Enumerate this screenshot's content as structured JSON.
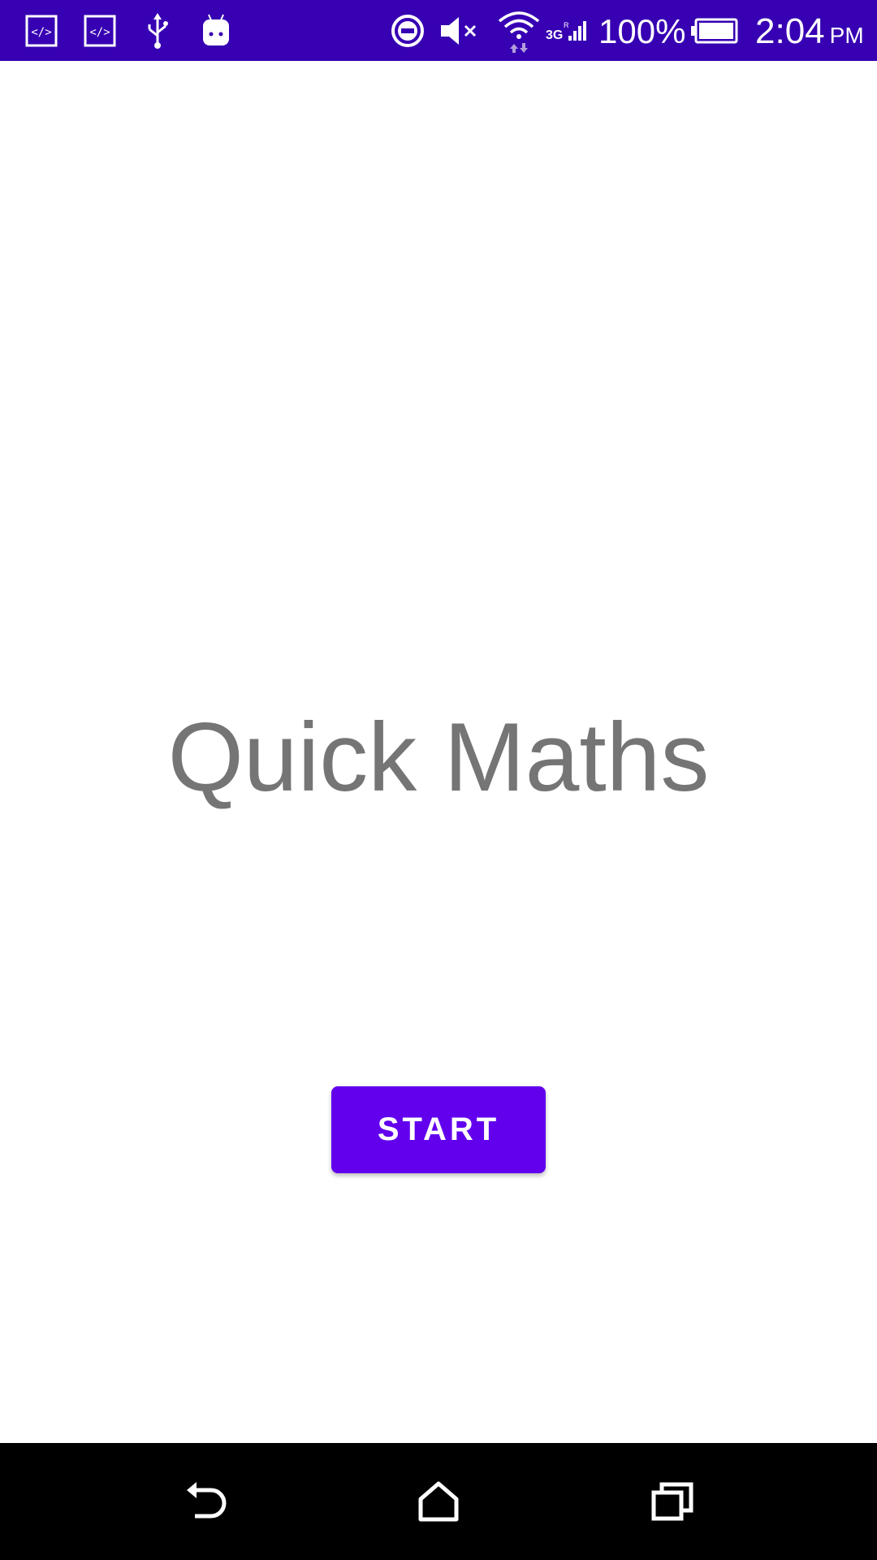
{
  "status_bar": {
    "background": "#3700b3",
    "left_icons": [
      "code-icon",
      "code-icon",
      "usb-icon",
      "android-icon"
    ],
    "right_icons": [
      "do-not-disturb-icon",
      "volume-muted-icon",
      "wifi-icon",
      "cellular-3g-signal-icon",
      "battery-icon"
    ],
    "network_label": "3G",
    "battery_percent": "100%",
    "time": "2:04",
    "ampm": "PM"
  },
  "main": {
    "title": "Quick Maths",
    "start_button_label": "START",
    "accent": "#6200ee",
    "title_color": "#757575"
  },
  "nav_bar": {
    "background": "#000000",
    "buttons": [
      "back-icon",
      "home-icon",
      "recents-icon"
    ]
  }
}
